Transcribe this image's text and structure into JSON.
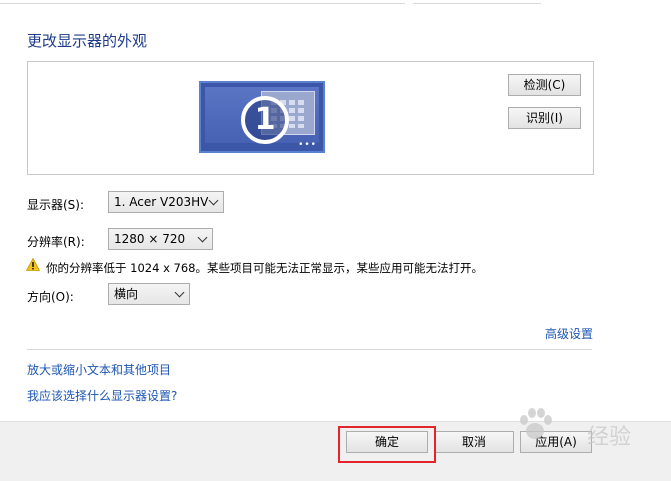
{
  "page": {
    "title": "更改显示器的外观"
  },
  "preview": {
    "monitor_number": "1",
    "detect_button": "检测(C)",
    "identify_button": "识别(I)"
  },
  "settings": {
    "display_label": "显示器(S):",
    "display_value": "1. Acer V203HV",
    "resolution_label": "分辨率(R):",
    "resolution_value": "1280 × 720",
    "warning_text": "你的分辨率低于 1024 x 768。某些项目可能无法正常显示，某些应用可能无法打开。",
    "orientation_label": "方向(O):",
    "orientation_value": "横向",
    "advanced_link": "高级设置"
  },
  "links": {
    "enlarge_text": "放大或缩小文本和其他项目",
    "which_settings": "我应该选择什么显示器设置?"
  },
  "footer": {
    "ok_button": "确定",
    "cancel_button": "取消",
    "apply_button": "应用(A)"
  },
  "watermark": {
    "text": "经验"
  },
  "colors": {
    "title": "#1e3b8c",
    "link": "#1e56b3",
    "highlight_box": "#e3242b",
    "monitor": "#3d57a8"
  }
}
